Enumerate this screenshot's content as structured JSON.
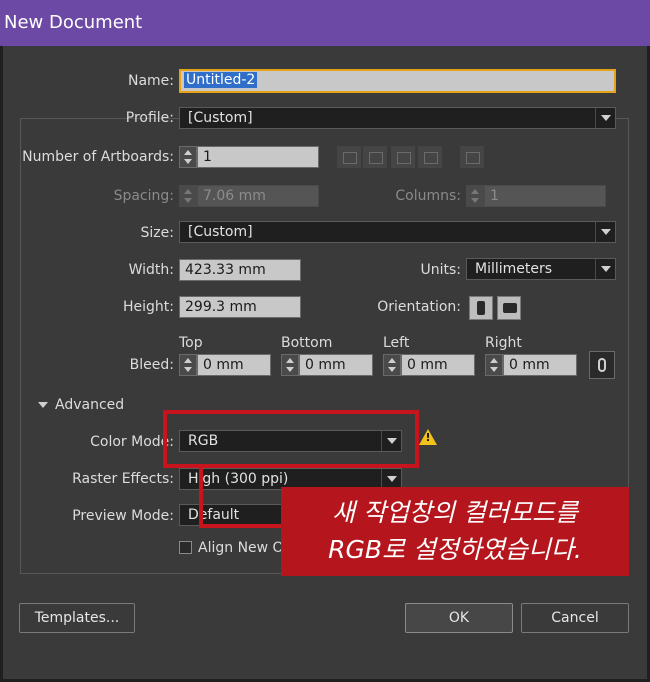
{
  "window": {
    "title": "New Document"
  },
  "form": {
    "name": {
      "label": "Name:",
      "value": "Untitled-2"
    },
    "profile": {
      "label": "Profile:",
      "value": "[Custom]"
    },
    "artboards": {
      "label": "Number of Artboards:",
      "value": "1"
    },
    "spacing": {
      "label": "Spacing:",
      "value": "7.06 mm"
    },
    "columns": {
      "label": "Columns:",
      "value": "1"
    },
    "size": {
      "label": "Size:",
      "value": "[Custom]"
    },
    "width": {
      "label": "Width:",
      "value": "423.33 mm"
    },
    "units": {
      "label": "Units:",
      "value": "Millimeters"
    },
    "height": {
      "label": "Height:",
      "value": "299.3 mm"
    },
    "orientation": {
      "label": "Orientation:"
    },
    "bleed": {
      "label": "Bleed:",
      "top": {
        "label": "Top",
        "value": "0 mm"
      },
      "bottom": {
        "label": "Bottom",
        "value": "0 mm"
      },
      "left": {
        "label": "Left",
        "value": "0 mm"
      },
      "right": {
        "label": "Right",
        "value": "0 mm"
      }
    },
    "advanced": {
      "label": "Advanced"
    },
    "color_mode": {
      "label": "Color Mode:",
      "value": "RGB"
    },
    "raster_effects": {
      "label": "Raster Effects:",
      "value": "High (300 ppi)"
    },
    "preview_mode": {
      "label": "Preview Mode:",
      "value": "Default"
    },
    "align_pixel_grid": {
      "label": "Align New Obje"
    }
  },
  "buttons": {
    "templates": "Templates...",
    "ok": "OK",
    "cancel": "Cancel"
  },
  "annotation": {
    "line1": "새 작업창의 컬러모드를",
    "line2": "RGB로 설정하였습니다."
  },
  "colors": {
    "titlebar": "#6d49a6",
    "annotation_red": "#c8141c",
    "warning": "#f2c21b",
    "focus": "#e6a317"
  },
  "icons": {
    "warning": "warning-triangle-icon",
    "link": "chain-link-icon"
  }
}
